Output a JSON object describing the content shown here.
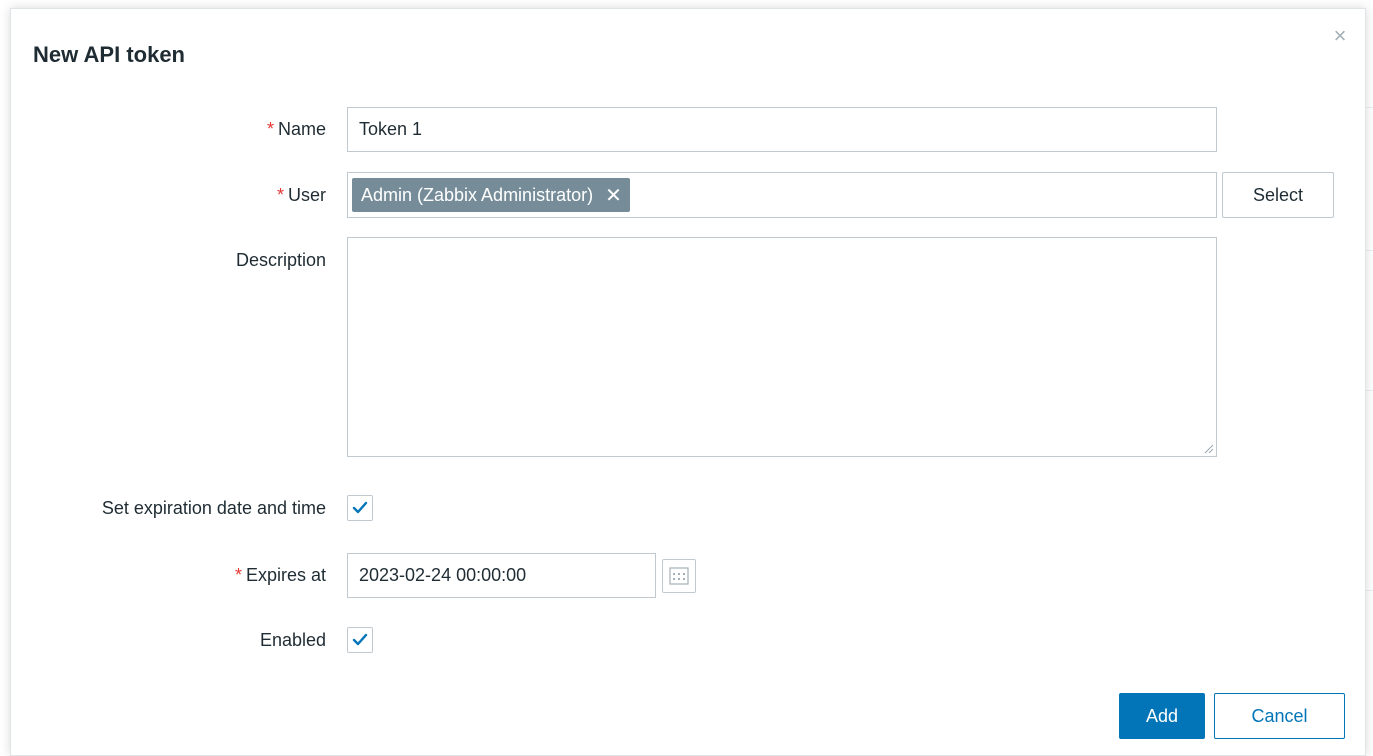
{
  "dialog": {
    "title": "New API token",
    "close_symbol": "×"
  },
  "form": {
    "name": {
      "required_mark": "*",
      "label": "Name",
      "value": "Token 1"
    },
    "user": {
      "required_mark": "*",
      "label": "User",
      "selected_tag": "Admin (Zabbix Administrator)",
      "remove_symbol": "✕",
      "select_button": "Select"
    },
    "description": {
      "label": "Description",
      "value": ""
    },
    "set_expiration": {
      "label": "Set expiration date and time",
      "checked": true
    },
    "expires_at": {
      "required_mark": "*",
      "label": "Expires at",
      "value": "2023-02-24 00:00:00"
    },
    "enabled": {
      "label": "Enabled",
      "checked": true
    }
  },
  "footer": {
    "add_button": "Add",
    "cancel_button": "Cancel"
  },
  "colors": {
    "primary": "#0275b8",
    "required": "#e33734",
    "tag_bg": "#768d99",
    "border": "#bfc9cf"
  },
  "icons": {
    "close": "close-icon",
    "tag_remove": "remove-tag-icon",
    "checkbox_check": "checkmark-icon",
    "calendar": "calendar-icon",
    "resize": "resize-grip-icon"
  }
}
